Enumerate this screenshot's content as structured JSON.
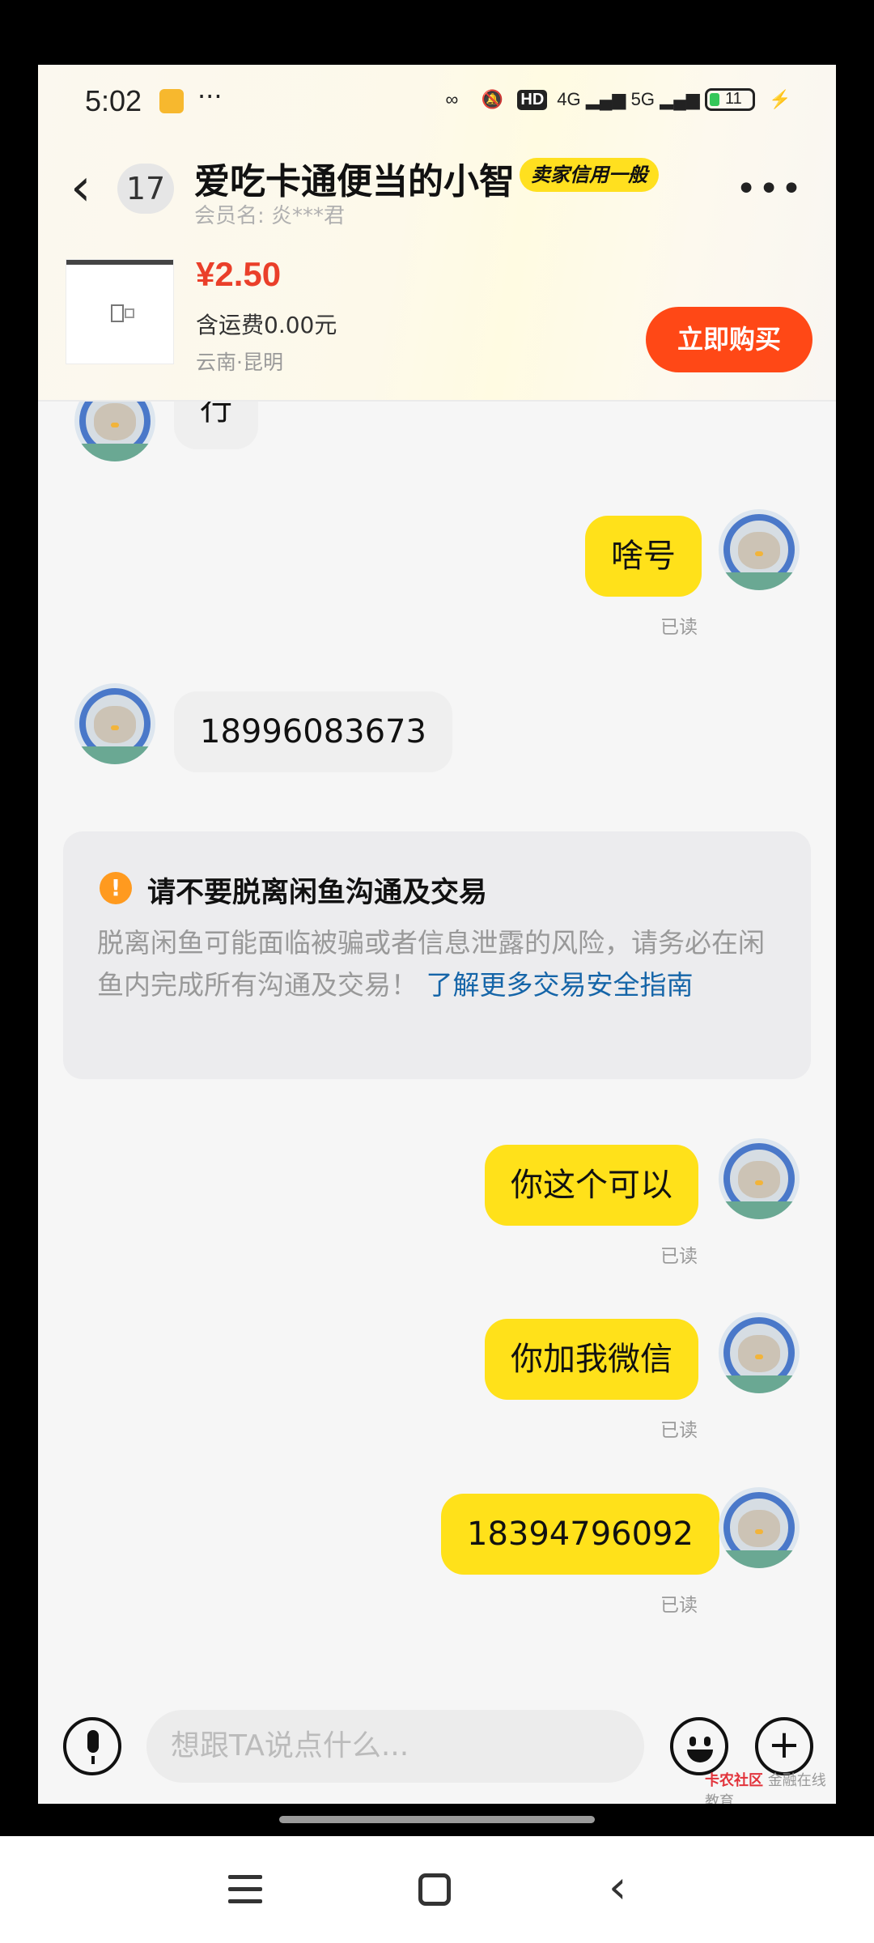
{
  "status_bar": {
    "time": "5:02",
    "more": "···",
    "network_1": "4G",
    "network_2": "5G",
    "hd": "HD",
    "battery": "11"
  },
  "header": {
    "unread_count": "17",
    "title": "爱吃卡通便当的小智",
    "credit_badge": "卖家信用一般",
    "member_name": "会员名: 炎***君",
    "more_icon": "•••"
  },
  "product": {
    "price": "¥2.50",
    "shipping": "含运费0.00元",
    "location": "云南·昆明",
    "buy_button": "立即购买"
  },
  "messages": [
    {
      "side": "in",
      "text": "行"
    },
    {
      "side": "out",
      "text": "啥号",
      "read": "已读"
    },
    {
      "side": "in",
      "text": "18996083673"
    },
    {
      "side": "out",
      "text": "你这个可以",
      "read": "已读"
    },
    {
      "side": "out",
      "text": "你加我微信",
      "read": "已读"
    },
    {
      "side": "out",
      "text": "18394796092",
      "read": "已读"
    }
  ],
  "warning": {
    "title": "请不要脱离闲鱼沟通及交易",
    "body": "脱离闲鱼可能面临被骗或者信息泄露的风险，请务必在闲鱼内完成所有沟通及交易！ ",
    "link": "了解更多交易安全指南"
  },
  "input": {
    "placeholder": "想跟TA说点什么..."
  },
  "watermark": {
    "brand": "卡农社区",
    "sub": "金融在线教育"
  },
  "colors": {
    "accent_yellow": "#ffe11a",
    "buy_red": "#ff4816",
    "price_red": "#ea3f2a",
    "link_blue": "#1565a8",
    "warning_orange": "#ff9a1f"
  }
}
